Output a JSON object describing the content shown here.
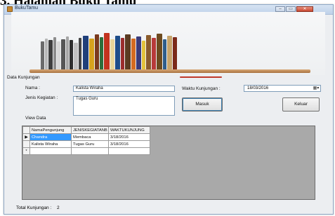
{
  "doc_heading": "Halaman Buku Tamu",
  "window": {
    "title": "BukuTamu",
    "controls": {
      "minimize": "–",
      "maximize": "▭",
      "close": "✕"
    }
  },
  "form": {
    "group_label": "Data Kunjungan",
    "nama_label": "Nama :",
    "nama_value": "Kalista Wiraha",
    "jenis_label": "Jenis Kegiatan :",
    "jenis_value": "Tugas Guru",
    "waktu_label": "Waktu Kunjungan :",
    "waktu_value": "18/03/2016",
    "masuk_button": "Masuk",
    "keluar_button": "Keluar"
  },
  "view_data": {
    "label": "View Data",
    "columns": [
      "NamaPengunjung",
      "JENISKEGIATANB",
      "WAKTUKUNJUNG"
    ],
    "rows": [
      {
        "marker": "▶",
        "nama": "Chandra",
        "jenis": "Membaca",
        "waktu": "3/18/2016"
      },
      {
        "marker": "",
        "nama": "Kalista Wiraha",
        "jenis": "Tugas Guru",
        "waktu": "3/18/2016"
      },
      {
        "marker": "*",
        "nama": "",
        "jenis": "",
        "waktu": ""
      }
    ]
  },
  "footer": {
    "total_label": "Total Kunjungan :",
    "total_value": "2"
  },
  "colors": {
    "selection": "#3399ff",
    "grid_background": "#a9a9a9",
    "titlebar": "#bfd2ea",
    "close_button": "#c8472f"
  }
}
